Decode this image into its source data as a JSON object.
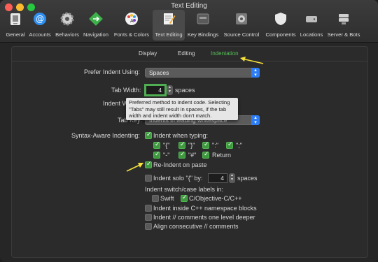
{
  "window": {
    "title": "Text Editing"
  },
  "toolbar": {
    "items": [
      {
        "label": "General",
        "icon": "general-icon"
      },
      {
        "label": "Accounts",
        "icon": "at-sign-icon"
      },
      {
        "label": "Behaviors",
        "icon": "gear-icon"
      },
      {
        "label": "Navigation",
        "icon": "navigation-icon"
      },
      {
        "label": "Fonts & Colors",
        "icon": "palette-icon"
      },
      {
        "label": "Text Editing",
        "icon": "text-editing-icon",
        "active": true
      },
      {
        "label": "Key Bindings",
        "icon": "keyboard-icon"
      },
      {
        "label": "Source Control",
        "icon": "source-control-icon"
      },
      {
        "label": "Components",
        "icon": "shield-icon"
      },
      {
        "label": "Locations",
        "icon": "drive-icon"
      },
      {
        "label": "Server & Bots",
        "icon": "server-icon"
      }
    ]
  },
  "tabs": {
    "display": "Display",
    "editing": "Editing",
    "indentation": "Indentation",
    "active": "Indentation"
  },
  "indent": {
    "prefer_label": "Prefer Indent Using:",
    "prefer_value": "Spaces",
    "tab_width_label": "Tab Width:",
    "tab_width_value": "4",
    "tab_width_unit": "spaces",
    "indent_width_label": "Indent W",
    "tab_key_label": "Tab Key:",
    "tab_key_value": "Indents in leading whitespace",
    "tooltip": "Preferred method to indent code. Selecting \"Tabs\" may still result in spaces, if the tab width and indent width don't match."
  },
  "syntax": {
    "label": "Syntax-Aware Indenting:",
    "indent_when_typing": "Indent when typing:",
    "chars": [
      {
        "label": "\"{\"",
        "checked": true
      },
      {
        "label": "\"}\"",
        "checked": true
      },
      {
        "label": "\":\"",
        "checked": true
      },
      {
        "label": "\";\"",
        "checked": true
      },
      {
        "label": "\"-\"",
        "checked": true
      },
      {
        "label": "\"#\"",
        "checked": true
      },
      {
        "label": "Return",
        "checked": true
      }
    ],
    "reindent_on_paste": "Re-Indent on paste",
    "indent_solo_label": "Indent solo \"{\" by:",
    "indent_solo_value": "4",
    "indent_solo_unit": "spaces",
    "switch_case_label": "Indent switch/case labels in:",
    "swift": "Swift",
    "objc": "C/Objective-C/C++",
    "cpp_namespace": "Indent inside C++ namespace blocks",
    "comments_deeper": "Indent // comments one level deeper",
    "align_comments": "Align consecutive // comments"
  },
  "colors": {
    "accent": "#2d7df6",
    "checkbox": "#3f9a3f",
    "annotation": "#f5e13a",
    "active_tab": "#55c257"
  }
}
